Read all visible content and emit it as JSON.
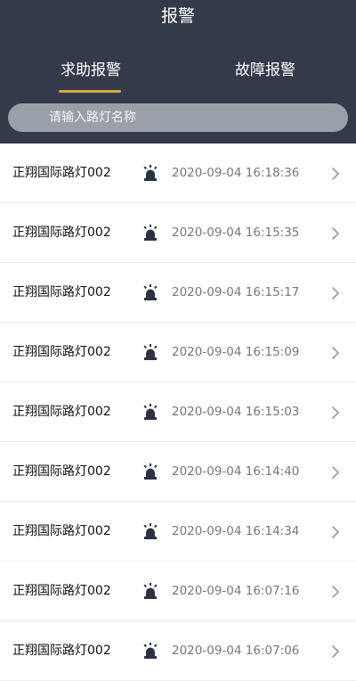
{
  "header": {
    "title": "报警",
    "tabs": [
      {
        "label": "求助报警",
        "active": true
      },
      {
        "label": "故障报警",
        "active": false
      }
    ],
    "search": {
      "placeholder": "请输入路灯名称",
      "value": ""
    }
  },
  "colors": {
    "header_bg": "#333a4a",
    "tab_indicator": "#d9a441",
    "search_bg": "#9aa0aa",
    "time_text": "#777777"
  },
  "alarms": [
    {
      "name": "正翔国际路灯002",
      "icon": "alarm-siren-icon",
      "time": "2020-09-04 16:18:36"
    },
    {
      "name": "正翔国际路灯002",
      "icon": "alarm-siren-icon",
      "time": "2020-09-04 16:15:35"
    },
    {
      "name": "正翔国际路灯002",
      "icon": "alarm-siren-icon",
      "time": "2020-09-04 16:15:17"
    },
    {
      "name": "正翔国际路灯002",
      "icon": "alarm-siren-icon",
      "time": "2020-09-04 16:15:09"
    },
    {
      "name": "正翔国际路灯002",
      "icon": "alarm-siren-icon",
      "time": "2020-09-04 16:15:03"
    },
    {
      "name": "正翔国际路灯002",
      "icon": "alarm-siren-icon",
      "time": "2020-09-04 16:14:40"
    },
    {
      "name": "正翔国际路灯002",
      "icon": "alarm-siren-icon",
      "time": "2020-09-04 16:14:34"
    },
    {
      "name": "正翔国际路灯002",
      "icon": "alarm-siren-icon",
      "time": "2020-09-04 16:07:16"
    },
    {
      "name": "正翔国际路灯002",
      "icon": "alarm-siren-icon",
      "time": "2020-09-04 16:07:06"
    }
  ]
}
